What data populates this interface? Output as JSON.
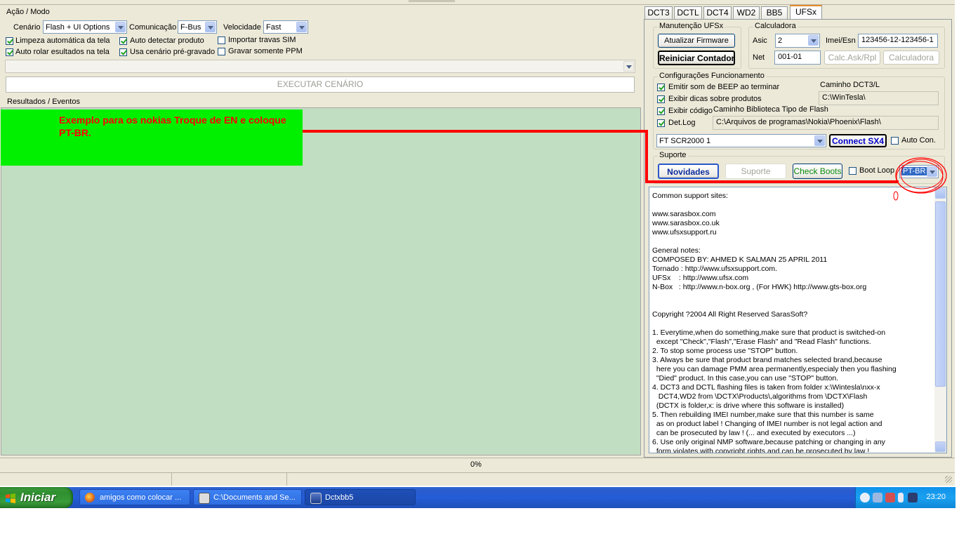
{
  "left_panel": {
    "group_acao_label": "Ação / Modo",
    "cenario_label": "Cenário",
    "cenario_value": "Flash + UI Options",
    "comunicacao_label": "Comunicação",
    "comunicacao_value": "F-Bus",
    "velocidade_label": "Velocidade",
    "velocidade_value": "Fast",
    "checkboxes": [
      {
        "label": "Limpeza automática da tela",
        "checked": true
      },
      {
        "label": "Auto detectar produto",
        "checked": true
      },
      {
        "label": "Importar travas SIM",
        "checked": false
      },
      {
        "label": "Auto rolar esultados na tela",
        "checked": true
      },
      {
        "label": "Usa cenário pré-gravado",
        "checked": true
      },
      {
        "label": "Gravar somente PPM",
        "checked": false
      }
    ],
    "execute_button": "EXECUTAR CENÁRIO",
    "results_label": "Resultados / Eventos",
    "annotation_text": "Exemplo para os nokias  Troque de EN e coloque PT-BR."
  },
  "tabs": [
    {
      "label": "DCT3"
    },
    {
      "label": "DCTL"
    },
    {
      "label": "DCT4"
    },
    {
      "label": "WD2"
    },
    {
      "label": "BB5"
    },
    {
      "label": "UFSx"
    }
  ],
  "right_panel": {
    "manutencao_label": "Manutenção UFSx",
    "atualizar_button": "Atualizar Firmware",
    "reiniciar_button": "Reiniciar Contador",
    "calculadora_group": "Calculadora",
    "asic_label": "Asic",
    "asic_value": "2",
    "imei_label": "Imei/Esn",
    "imei_value": "123456-12-123456-1",
    "net_label": "Net",
    "net_value": "001-01",
    "calc_ask_button": "Calc.Ask/Rpl",
    "calculadora_button": "Calculadora",
    "config_group": "Configurações Funcionamento",
    "beep_label": "Emitir som de BEEP ao terminar",
    "dicas_label": "Exibir dicas sobre produtos",
    "codigo_label": "Exibir código",
    "detlog_label": "Det.Log",
    "caminho_dct3_label": "Caminho DCT3/L",
    "caminho_dct3_value": "C:\\WinTesla\\",
    "caminho_flash_label": "Caminho Biblioteca Tipo de Flash",
    "caminho_flash_value": "C:\\Arquivos de programas\\Nokia\\Phoenix\\Flash\\",
    "device_value": "FT SCR2000 1",
    "connect_button": "Connect SX4",
    "auto_con_label": "Auto Con.",
    "suporte_group": "Suporte",
    "novidades_button": "Novidades",
    "suporte_button": "Suporte",
    "check_boots_button": "Check Boots",
    "boot_loop_label": "Boot Loop",
    "language_value": "PT-BR",
    "info_text": "Common support sites:\n\nwww.sarasbox.com\nwww.sarasbox.co.uk\nwww.ufsxsupport.ru\n\nGeneral notes:\nCOMPOSED BY: AHMED K SALMAN 25 APRIL 2011\nTornado : http://www.ufsxsupport.com.\nUFSx    : http://www.ufsx.com\nN-Box   : http://www.n-box.org , (For HWK) http://www.gts-box.org\n\n\nCopyright ?2004 All Right Reserved SarasSoft?\n\n1. Everytime,when do something,make sure that product is switched-on\n  except \"Check\",\"Flash\",\"Erase Flash\" and \"Read Flash\" functions.\n2. To stop some process use \"STOP\" button.\n3. Always be sure that product brand matches selected brand,because\n  here you can damage PMM area permanently,especialy then you flashing\n  \"Died\" product. In this case,you can use \"STOP\" button.\n4. DCT3 and DCTL flashing files is taken from folder x:\\Wintesla\\nxx-x\n   DCT4,WD2 from \\DCTX\\Products\\,algorithms from \\DCTX\\Flash\n  (DCTX is folder,x: is drive where this software is installed)\n5. Then rebuilding IMEI number,make sure that this number is same\n  as on product label ! Changing of IMEI number is not legal action and\n  can be prosecuted by law ! (... and executed by executors ...)\n6. Use only original NMP software,because patching or changing in any\n  form violates with copyright rights and can be prosecuted by law !"
  },
  "status": {
    "progress_text": "0%"
  },
  "taskbar": {
    "start_label": "Iniciar",
    "items": [
      {
        "label": "amigos como colocar ..."
      },
      {
        "label": "C:\\Documents and Se..."
      },
      {
        "label": "Dctxbb5"
      }
    ],
    "clock": "23:20"
  },
  "colors": {
    "annotation_red": "#ff0000",
    "highlight_green": "#00f000",
    "results_bg": "#c2dec2",
    "taskbar_blue": "#245dd8"
  }
}
